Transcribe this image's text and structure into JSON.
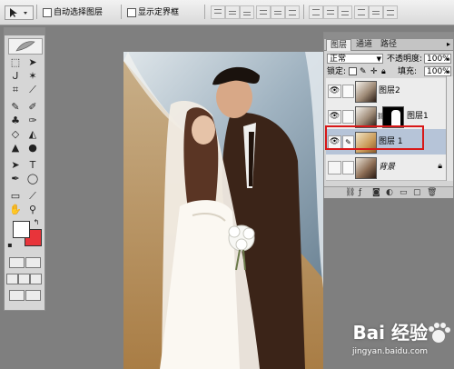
{
  "options_bar": {
    "auto_select_label": "自动选择图层",
    "show_bounds_label": "显示定界框"
  },
  "layers_panel": {
    "tabs": [
      "图层",
      "通道",
      "路径"
    ],
    "blend_mode": "正常",
    "opacity_label": "不透明度:",
    "opacity_value": "100%",
    "lock_label": "锁定:",
    "fill_label": "填充:",
    "fill_value": "100%",
    "layers": [
      {
        "name": "图层2",
        "visible": true,
        "selected": false,
        "has_mask": false
      },
      {
        "name": "图层1",
        "visible": false,
        "selected": false,
        "has_mask": true
      },
      {
        "name": "图层 1",
        "visible": true,
        "selected": true,
        "has_mask": false
      },
      {
        "name": "背景",
        "visible": false,
        "selected": false,
        "has_mask": false
      }
    ]
  },
  "watermark": {
    "main": "Bai 经验",
    "sub": "jingyan.baidu.com"
  },
  "colors": {
    "foreground": "#ffffff",
    "background": "#e8343a",
    "highlight": "#d81818"
  }
}
